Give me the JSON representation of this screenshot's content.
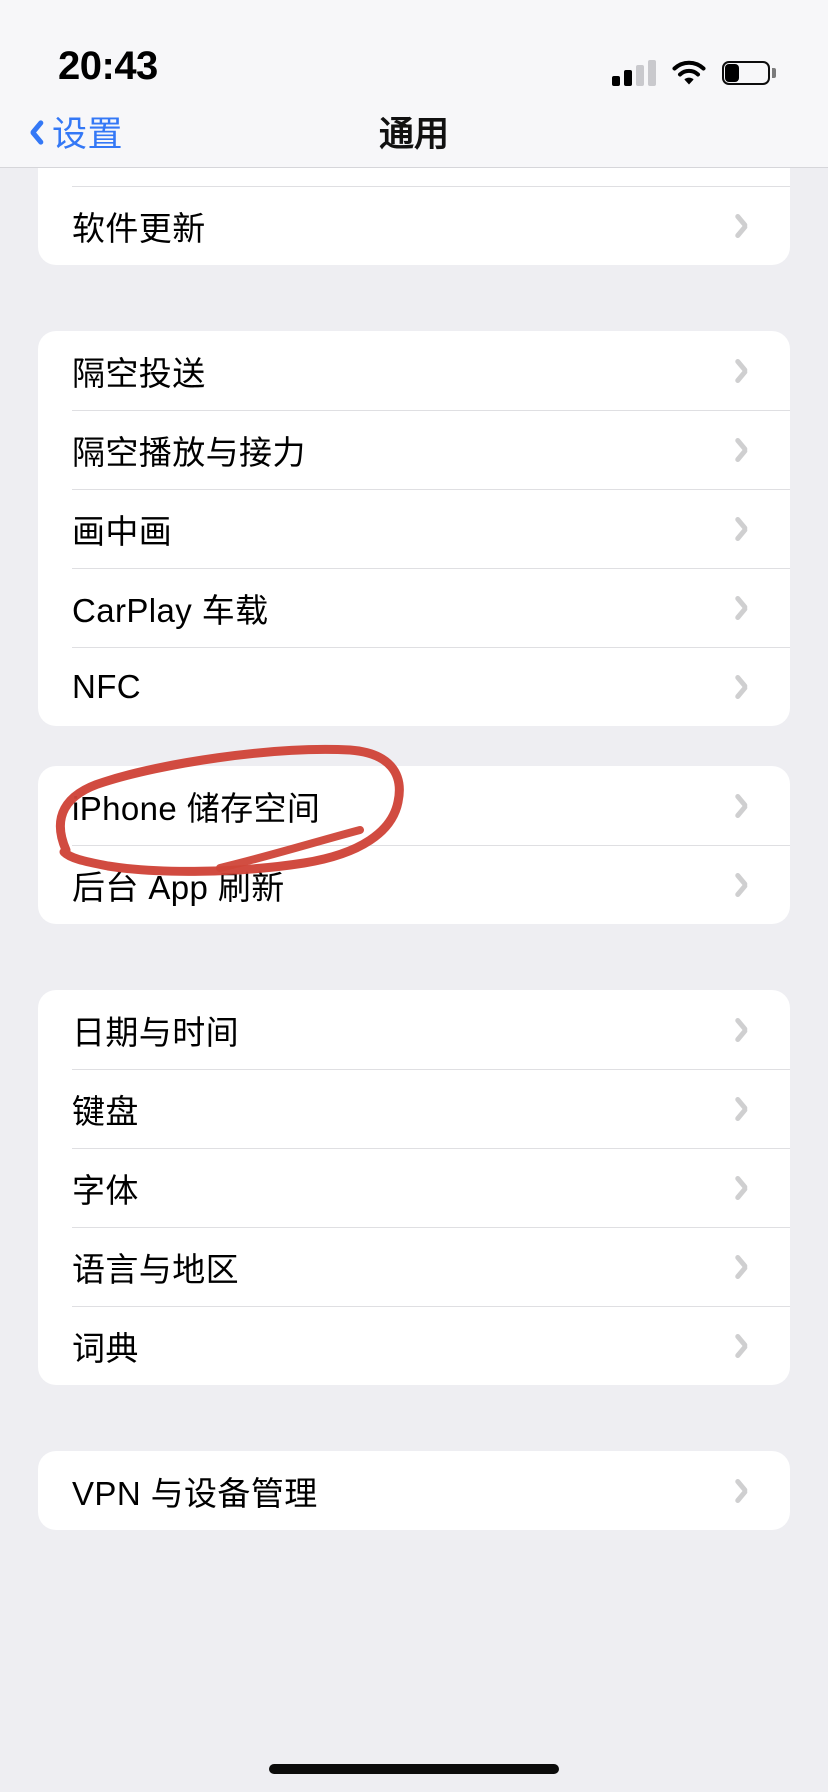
{
  "status_bar": {
    "time": "20:43",
    "signal_icon": "cellular-signal-icon",
    "signal_bars_total": 4,
    "signal_bars_active": 2,
    "wifi_icon": "wifi-icon",
    "battery_icon": "battery-icon",
    "battery_level_percent": 35
  },
  "nav": {
    "back_label": "设置",
    "back_icon": "chevron-left-icon",
    "title": "通用"
  },
  "sections": [
    {
      "id": "software-update",
      "partial": true,
      "rows": [
        {
          "label": "软件更新",
          "name": "software-update"
        }
      ]
    },
    {
      "id": "connectivity",
      "partial": false,
      "rows": [
        {
          "label": "隔空投送",
          "name": "airdrop"
        },
        {
          "label": "隔空播放与接力",
          "name": "airplay-handoff"
        },
        {
          "label": "画中画",
          "name": "picture-in-picture"
        },
        {
          "label": "CarPlay 车载",
          "name": "carplay"
        },
        {
          "label": "NFC",
          "name": "nfc"
        }
      ]
    },
    {
      "id": "storage",
      "partial": false,
      "rows": [
        {
          "label": "iPhone 储存空间",
          "name": "iphone-storage"
        },
        {
          "label": "后台 App 刷新",
          "name": "background-app-refresh"
        }
      ]
    },
    {
      "id": "locale",
      "partial": false,
      "rows": [
        {
          "label": "日期与时间",
          "name": "date-and-time"
        },
        {
          "label": "键盘",
          "name": "keyboard"
        },
        {
          "label": "字体",
          "name": "fonts"
        },
        {
          "label": "语言与地区",
          "name": "language-and-region"
        },
        {
          "label": "词典",
          "name": "dictionary"
        }
      ]
    },
    {
      "id": "vpn",
      "partial": false,
      "rows": [
        {
          "label": "VPN 与设备管理",
          "name": "vpn-device-management"
        }
      ]
    }
  ],
  "annotation": {
    "type": "hand-drawn-circle",
    "target_row": "iPhone 储存空间",
    "color": "#cf4438"
  },
  "colors": {
    "accent_blue": "#3478f6",
    "page_background": "#eeeef2",
    "card_background": "#ffffff",
    "separator": "#dfdfe2",
    "annotation_red": "#cf4438",
    "chevron_gray": "#6b6b70"
  }
}
